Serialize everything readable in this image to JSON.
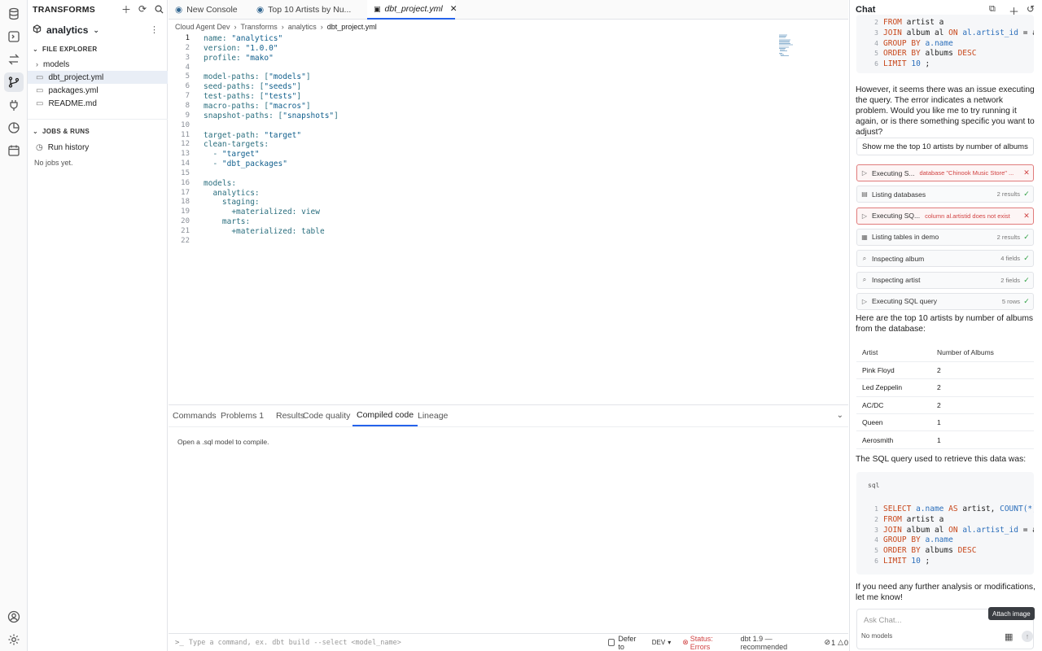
{
  "explorer": {
    "title": "TRANSFORMS",
    "project": "analytics",
    "file_explorer_label": "FILE EXPLORER",
    "items": [
      {
        "label": "models",
        "type": "folder"
      },
      {
        "label": "dbt_project.yml",
        "type": "file",
        "selected": true
      },
      {
        "label": "packages.yml",
        "type": "file"
      },
      {
        "label": "README.md",
        "type": "file"
      }
    ],
    "jobs_label": "JOBS & RUNS",
    "run_history": "Run history",
    "no_jobs": "No jobs yet."
  },
  "tabs": [
    {
      "label": "New Console"
    },
    {
      "label": "Top 10 Artists by Nu..."
    },
    {
      "label": "dbt_project.yml",
      "active": true
    }
  ],
  "breadcrumb": [
    "Cloud Agent Dev",
    "Transforms",
    "analytics",
    "dbt_project.yml"
  ],
  "editor": {
    "lines": [
      "name: \"analytics\"",
      "version: \"1.0.0\"",
      "profile: \"mako\"",
      "",
      "model-paths: [\"models\"]",
      "seed-paths: [\"seeds\"]",
      "test-paths: [\"tests\"]",
      "macro-paths: [\"macros\"]",
      "snapshot-paths: [\"snapshots\"]",
      "",
      "target-path: \"target\"",
      "clean-targets:",
      "  - \"target\"",
      "  - \"dbt_packages\"",
      "",
      "models:",
      "  analytics:",
      "    staging:",
      "      +materialized: view",
      "    marts:",
      "      +materialized: table",
      ""
    ]
  },
  "bottom_panel": {
    "tabs": [
      "Commands",
      "Problems 1",
      "Results",
      "Code quality",
      "Compiled code",
      "Lineage"
    ],
    "active_tab": "Compiled code",
    "message": "Open a .sql model to compile."
  },
  "status_bar": {
    "command_placeholder": "Type a command, ex. dbt build --select <model_name>",
    "defer_label": "Defer to",
    "env": "DEV",
    "status": "Status: Errors",
    "dbt_version": "dbt 1.9 — recommended",
    "errors": "1",
    "warnings": "0"
  },
  "chat": {
    "title": "Chat",
    "top_code": [
      {
        "n": "2",
        "tokens": [
          [
            "kw",
            "FROM"
          ],
          [
            "",
            "artist a"
          ]
        ]
      },
      {
        "n": "3",
        "tokens": [
          [
            "kw",
            "JOIN"
          ],
          [
            "",
            "album al"
          ],
          [
            "kw",
            "ON"
          ],
          [
            "fn",
            "al.artist_id"
          ],
          [
            "",
            "= a."
          ]
        ]
      },
      {
        "n": "4",
        "tokens": [
          [
            "kw",
            "GROUP BY"
          ],
          [
            "fn",
            "a.name"
          ]
        ]
      },
      {
        "n": "5",
        "tokens": [
          [
            "kw",
            "ORDER BY"
          ],
          [
            "",
            "albums"
          ],
          [
            "kw",
            "DESC"
          ]
        ]
      },
      {
        "n": "6",
        "tokens": [
          [
            "kw",
            "LIMIT"
          ],
          [
            "fn",
            "10"
          ],
          [
            "",
            ";"
          ]
        ]
      }
    ],
    "msg_error": "However, it seems there was an issue executing the query. The error indicates a network problem. Would you like me to try running it again, or is there something specific you want to adjust?",
    "user_msg": "Show me the top 10 artists by number of albums",
    "steps": [
      {
        "icon": "play",
        "label": "Executing S...",
        "error": "database \"Chinook Music Store\" ...",
        "status": "error"
      },
      {
        "icon": "db",
        "label": "Listing databases",
        "result": "2 results",
        "status": "ok"
      },
      {
        "icon": "play",
        "label": "Executing SQ...",
        "error": "column al.artistid does not exist",
        "status": "error"
      },
      {
        "icon": "table",
        "label": "Listing tables in demo",
        "result": "2 results",
        "status": "ok"
      },
      {
        "icon": "search",
        "label": "Inspecting album",
        "result": "4 fields",
        "status": "ok"
      },
      {
        "icon": "search",
        "label": "Inspecting artist",
        "result": "2 fields",
        "status": "ok"
      },
      {
        "icon": "play",
        "label": "Executing SQL query",
        "result": "5 rows",
        "status": "ok"
      }
    ],
    "msg_results": "Here are the top 10 artists by number of albums from the database:",
    "table": {
      "headers": [
        "Artist",
        "Number of Albums"
      ],
      "rows": [
        [
          "Pink Floyd",
          "2"
        ],
        [
          "Led Zeppelin",
          "2"
        ],
        [
          "AC/DC",
          "2"
        ],
        [
          "Queen",
          "1"
        ],
        [
          "Aerosmith",
          "1"
        ]
      ]
    },
    "msg_sql": "The SQL query used to retrieve this data was:",
    "code_lang": "sql",
    "code": [
      {
        "n": "1",
        "tokens": [
          [
            "kw",
            "SELECT"
          ],
          [
            "fn",
            "a.name"
          ],
          [
            "kw",
            "AS"
          ],
          [
            "",
            "artist,"
          ],
          [
            "fn",
            "COUNT(*)"
          ]
        ]
      },
      {
        "n": "2",
        "tokens": [
          [
            "kw",
            "FROM"
          ],
          [
            "",
            "artist a"
          ]
        ]
      },
      {
        "n": "3",
        "tokens": [
          [
            "kw",
            "JOIN"
          ],
          [
            "",
            "album al"
          ],
          [
            "kw",
            "ON"
          ],
          [
            "fn",
            "al.artist_id"
          ],
          [
            "",
            "= a."
          ]
        ]
      },
      {
        "n": "4",
        "tokens": [
          [
            "kw",
            "GROUP BY"
          ],
          [
            "fn",
            "a.name"
          ]
        ]
      },
      {
        "n": "5",
        "tokens": [
          [
            "kw",
            "ORDER BY"
          ],
          [
            "",
            "albums"
          ],
          [
            "kw",
            "DESC"
          ]
        ]
      },
      {
        "n": "6",
        "tokens": [
          [
            "kw",
            "LIMIT"
          ],
          [
            "fn",
            "10"
          ],
          [
            "",
            ";"
          ]
        ]
      }
    ],
    "msg_end": "If you need any further analysis or modifications, let me know!",
    "input_placeholder": "Ask Chat...",
    "model_label": "No models",
    "tooltip": "Attach image"
  },
  "colors": {
    "accent": "#2563eb",
    "error": "#d14343",
    "ok": "#2ea043"
  }
}
